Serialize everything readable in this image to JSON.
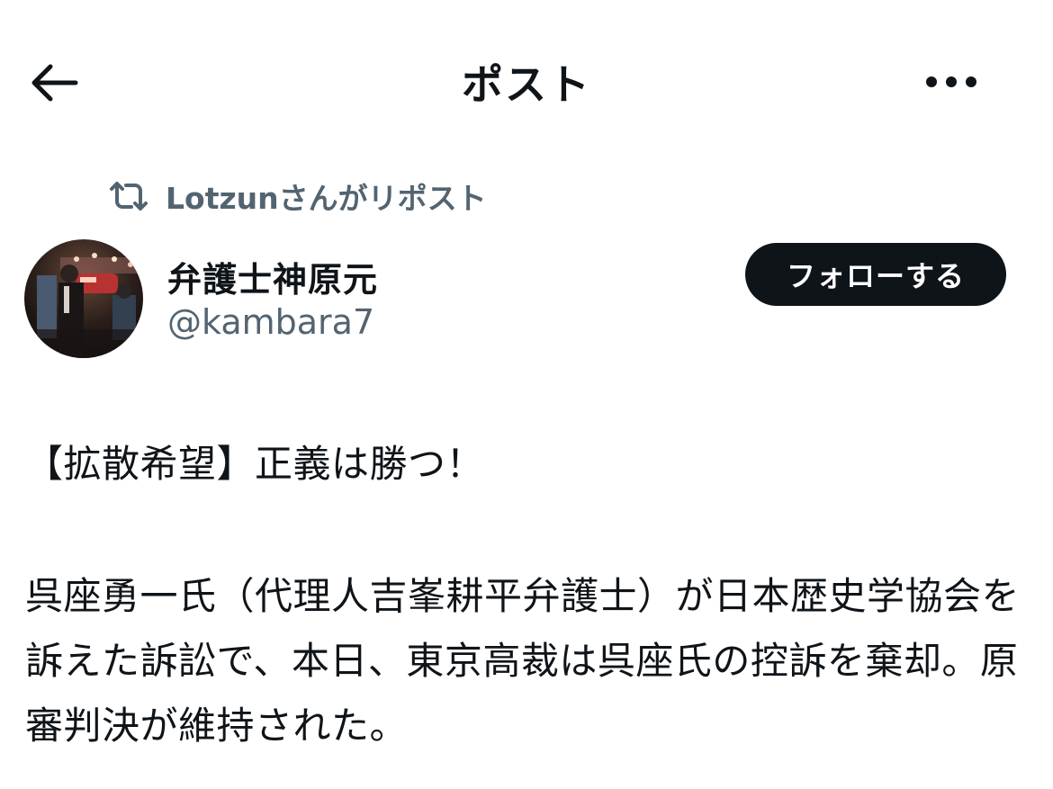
{
  "header": {
    "title": "ポスト",
    "back_icon": "arrow-left-icon",
    "more_icon": "more-horizontal-icon"
  },
  "repost": {
    "icon": "repost-icon",
    "text": "Lotzunさんがリポスト"
  },
  "author": {
    "display_name": "弁護士神原元",
    "handle": "@kambara7"
  },
  "follow_button": {
    "label": "フォローする"
  },
  "post": {
    "line1": "【拡散希望】正義は勝つ！",
    "paragraph2": "呉座勇一氏（代理人吉峯耕平弁護士）が日本歴史学協会を訴えた訴訟で、本日、東京高裁は呉座氏の控訴を棄却。原審判決が維持された。"
  },
  "colors": {
    "text_primary": "#0f1419",
    "text_secondary": "#536471",
    "button_bg": "#0f1419",
    "button_text": "#ffffff",
    "background": "#ffffff"
  }
}
